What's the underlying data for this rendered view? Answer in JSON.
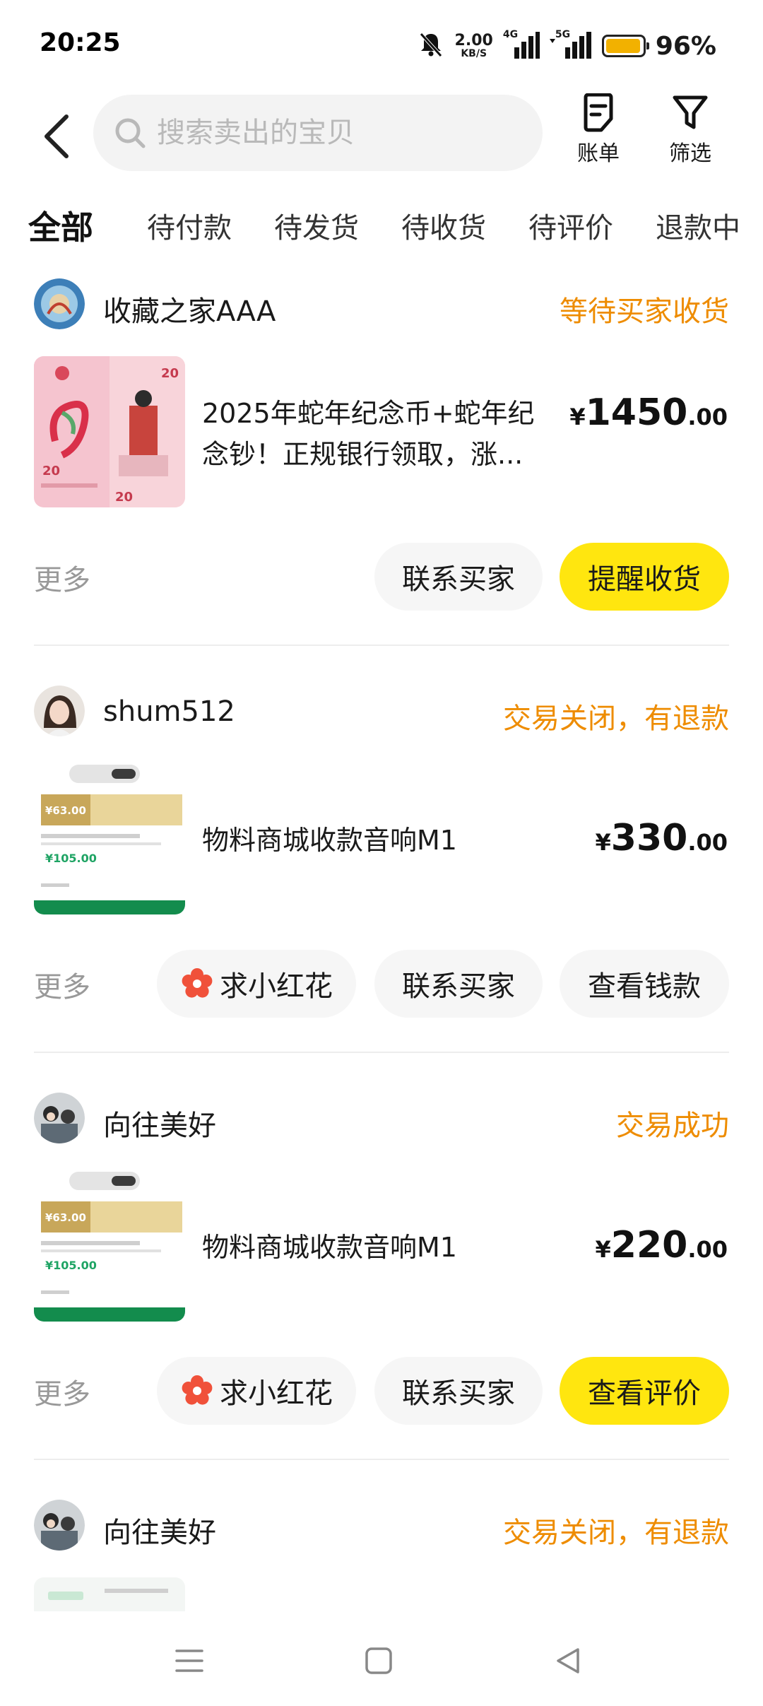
{
  "status_bar": {
    "time": "20:25",
    "net_speed_value": "2.00",
    "net_speed_unit": "KB/S",
    "signal_1_label": "4G",
    "signal_2_label": "5G",
    "battery_level": 0.96,
    "battery_percent": "96%"
  },
  "header": {
    "search_placeholder": "搜索卖出的宝贝",
    "bill_label": "账单",
    "filter_label": "筛选"
  },
  "tabs": [
    {
      "label": "全部",
      "active": true
    },
    {
      "label": "待付款"
    },
    {
      "label": "待发货"
    },
    {
      "label": "待收货"
    },
    {
      "label": "待评价"
    },
    {
      "label": "退款中"
    }
  ],
  "orders": [
    {
      "seller": "收藏之家AAA",
      "status": "等待买家收货",
      "title": "2025年蛇年纪念币+蛇年纪念钞！正规银行领取，涨...",
      "price_currency": "¥",
      "price_int": "1450",
      "price_dec": ".00",
      "more": "更多",
      "buttons": [
        "联系买家",
        "提醒收货"
      ],
      "thumb_text": "20"
    },
    {
      "seller": "shum512",
      "status": "交易关闭，有退款",
      "title": "物料商城收款音响M1",
      "price_currency": "¥",
      "price_int": "330",
      "price_dec": ".00",
      "more": "更多",
      "buttons": [
        "求小红花",
        "联系买家",
        "查看钱款"
      ],
      "thumb_price_top": "¥63.00",
      "thumb_price_bottom": "¥105.00"
    },
    {
      "seller": "向往美好",
      "status": "交易成功",
      "title": "物料商城收款音响M1",
      "price_currency": "¥",
      "price_int": "220",
      "price_dec": ".00",
      "more": "更多",
      "buttons": [
        "求小红花",
        "联系买家",
        "查看评价"
      ],
      "thumb_price_top": "¥63.00",
      "thumb_price_bottom": "¥105.00"
    },
    {
      "seller": "向往美好",
      "status": "交易关闭，有退款"
    }
  ],
  "colors": {
    "accent_yellow": "#ffe60f",
    "status_orange": "#ee8c00",
    "pill_gray": "#f6f6f6",
    "flower_red": "#f0513a"
  }
}
